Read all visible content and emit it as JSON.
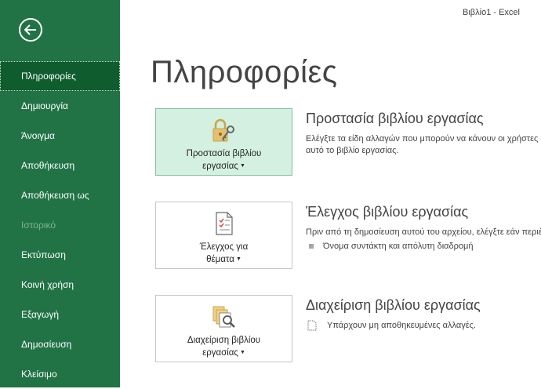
{
  "window": {
    "title": "Βιβλίο1  -  Excel"
  },
  "sidebar": {
    "back_icon": "back-arrow-icon",
    "items": [
      {
        "label": "Πληροφορίες",
        "active": true
      },
      {
        "label": "Δημιουργία"
      },
      {
        "label": "Άνοιγμα"
      },
      {
        "label": "Αποθήκευση"
      },
      {
        "label": "Αποθήκευση ως"
      },
      {
        "label": "Ιστορικό",
        "disabled": true
      },
      {
        "label": "Εκτύπωση"
      },
      {
        "label": "Κοινή χρήση"
      },
      {
        "label": "Εξαγωγή"
      },
      {
        "label": "Δημοσίευση"
      },
      {
        "label": "Κλείσιμο"
      }
    ]
  },
  "main": {
    "title": "Πληροφορίες",
    "protect": {
      "button_line1": "Προστασία βιβλίου",
      "button_line2": "εργασίας",
      "heading": "Προστασία βιβλίου εργασίας",
      "desc_line1": "Ελέγξτε τα είδη αλλαγών που μπορούν να κάνουν οι χρήστες σε",
      "desc_line2": "αυτό το βιβλίο εργασίας.",
      "icon": "lock-key-icon"
    },
    "inspect": {
      "button_line1": "Έλεγχος για",
      "button_line2": "θέματα",
      "heading": "Έλεγχος βιβλίου εργασίας",
      "desc_line1": "Πριν από τη δημοσίευση αυτού του αρχείου, ελέγξτε εάν περιέχει:",
      "bullet1": "Όνομα συντάκτη και απόλυτη διαδρομή",
      "icon": "inspect-document-icon"
    },
    "manage": {
      "button_line1": "Διαχείριση βιβλίου",
      "button_line2": "εργασίας",
      "heading": "Διαχείριση βιβλίου εργασίας",
      "note": "Υπάρχουν μη αποθηκευμένες αλλαγές.",
      "icon": "manage-workbook-icon"
    }
  },
  "colors": {
    "sidebar": "#217346",
    "sidebar_active": "#0f5c2e",
    "selected_button": "#d3f0e0"
  }
}
